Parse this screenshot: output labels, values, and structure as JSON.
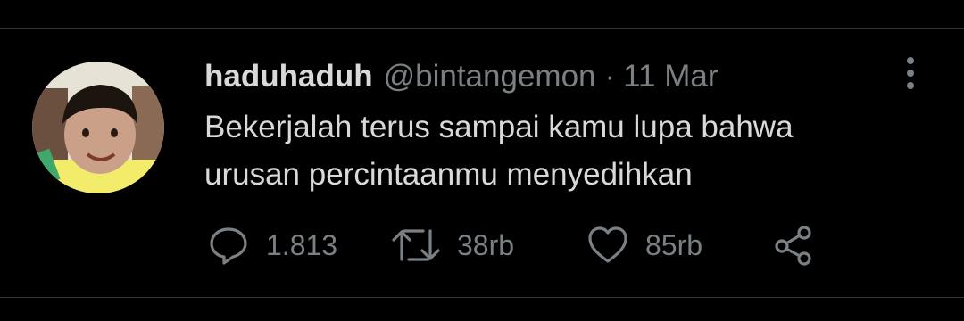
{
  "tweet": {
    "display_name": "haduhaduh",
    "handle": "@bintangemon",
    "separator": "·",
    "date": "11 Mar",
    "text_lines": [
      "Bekerjalah terus sampai kamu lupa bahwa",
      "urusan percintaanmu menyedihkan"
    ]
  },
  "actions": {
    "reply_count": "1.813",
    "retweet_count": "38rb",
    "like_count": "85rb"
  },
  "icons": {
    "reply": "reply-icon",
    "retweet": "retweet-icon",
    "like": "heart-icon",
    "share": "share-icon",
    "more": "more-vertical-icon"
  },
  "colors": {
    "background": "#000000",
    "primary_text": "#d9d9d9",
    "secondary_text": "#7b8084",
    "divider": "#2f3336"
  }
}
